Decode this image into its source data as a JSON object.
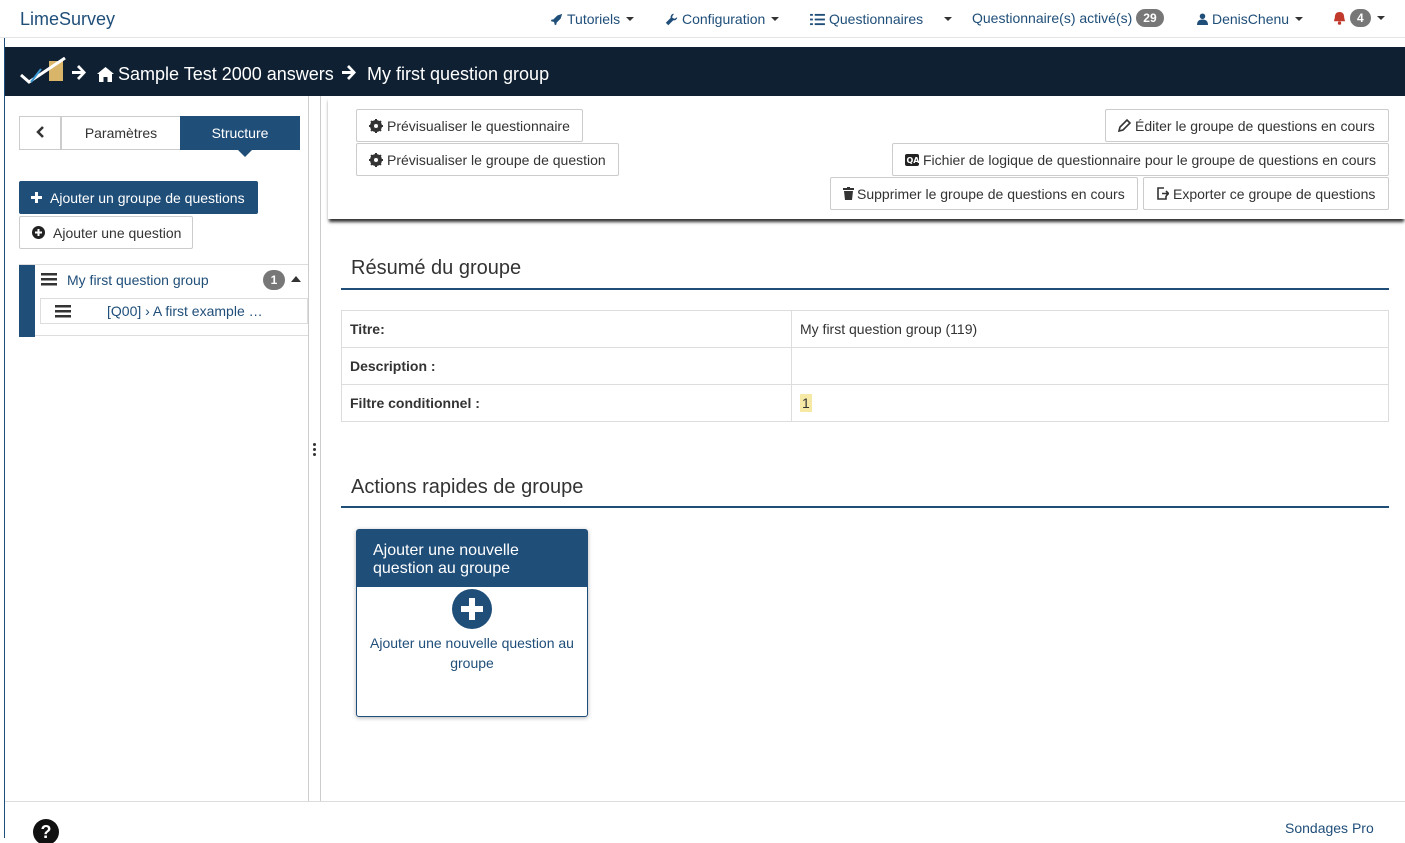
{
  "navbar": {
    "brand": "LimeSurvey",
    "tutorials": "Tutoriels",
    "configuration": "Configuration",
    "surveys": "Questionnaires",
    "active_surveys": "Questionnaire(s) activé(s)",
    "active_count": "29",
    "user": "DenisChenu",
    "notifications_count": "4"
  },
  "breadcrumb": {
    "survey": "Sample Test 2000 answers",
    "group": "My first question group"
  },
  "sidebar": {
    "tab_settings": "Paramètres",
    "tab_structure": "Structure",
    "add_group": "Ajouter un groupe de questions",
    "add_question": "Ajouter une question",
    "tree_group": "My first question group",
    "tree_group_count": "1",
    "tree_question": "[Q00] › A first example …"
  },
  "toolbar": {
    "preview_survey": "Prévisualiser le questionnaire",
    "preview_group": "Prévisualiser le groupe de question",
    "edit_group": "Éditer le groupe de questions en cours",
    "logic_file": "Fichier de logique de questionnaire pour le groupe de questions en cours",
    "delete_group": "Supprimer le groupe de questions en cours",
    "export_group": "Exporter ce groupe de questions"
  },
  "summary": {
    "heading": "Résumé du groupe",
    "rows": [
      {
        "label": "Titre:",
        "value": "My first question group (119)"
      },
      {
        "label": "Description :",
        "value": ""
      },
      {
        "label": "Filtre conditionnel :",
        "value": "1"
      }
    ]
  },
  "quick_actions": {
    "heading": "Actions rapides de groupe",
    "card_title": "Ajouter une nouvelle question au groupe",
    "card_text": "Ajouter une nouvelle question au groupe"
  },
  "footer": {
    "help": "?",
    "link": "Sondages Pro"
  },
  "colors": {
    "primary": "#1f4e79",
    "dark_bar": "#0f2033",
    "badge": "#777777",
    "highlight": "#f6e9a6"
  }
}
